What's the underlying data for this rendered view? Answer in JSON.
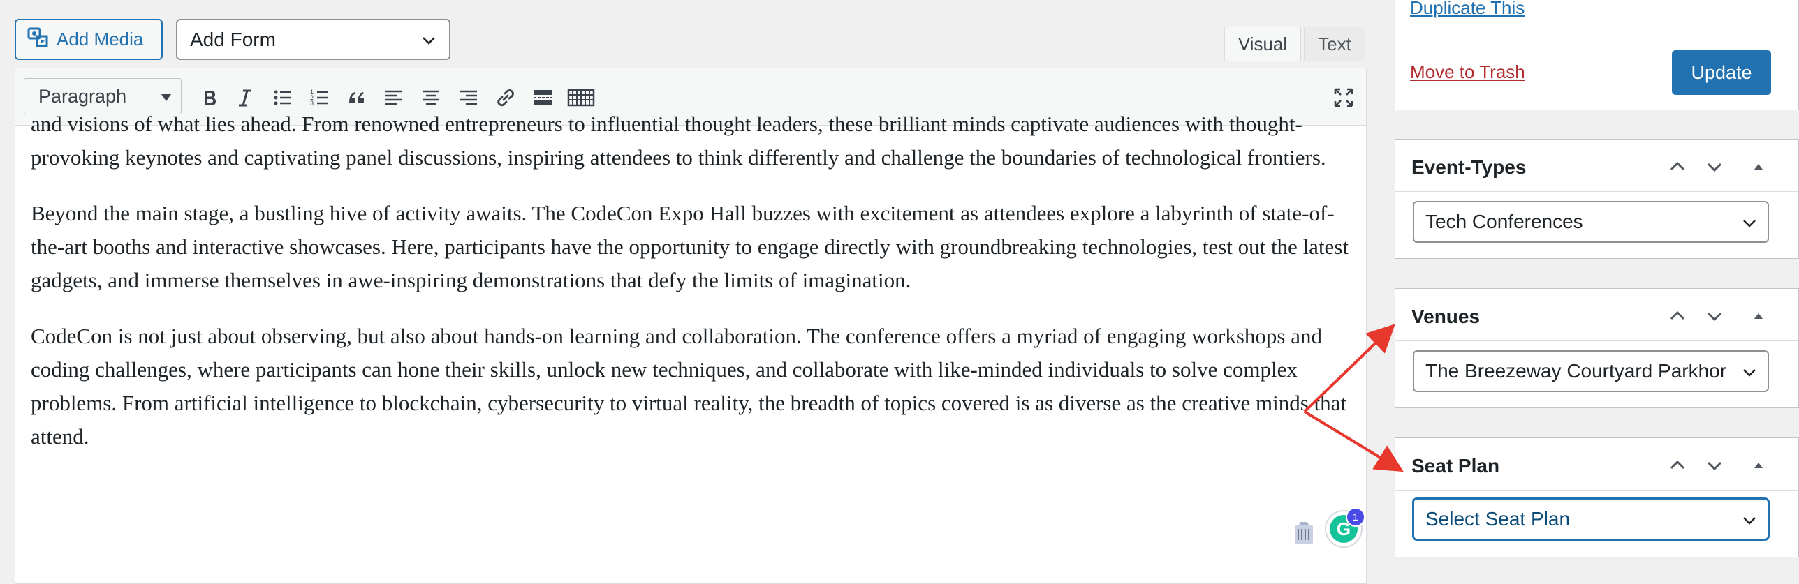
{
  "toolbar_top": {
    "add_media_label": "Add Media",
    "add_form_value": "Add Form",
    "tabs": [
      "Visual",
      "Text"
    ]
  },
  "editor_toolbar": {
    "format_select": "Paragraph",
    "buttons": [
      "bold-icon",
      "italic-icon",
      "bullet-list-icon",
      "numbered-list-icon",
      "blockquote-icon",
      "align-left-icon",
      "align-center-icon",
      "align-right-icon",
      "link-icon",
      "read-more-icon",
      "toolbar-toggle-icon",
      "fullscreen-icon"
    ]
  },
  "content": {
    "paragraphs": [
      "and visions of what lies ahead. From renowned entrepreneurs to influential thought leaders, these brilliant minds captivate audiences with thought-provoking keynotes and captivating panel discussions, inspiring attendees to think differently and challenge the boundaries of technological frontiers.",
      "Beyond the main stage, a bustling hive of activity awaits. The CodeCon Expo Hall buzzes with excitement as attendees explore a labyrinth of state-of-the-art booths and interactive showcases. Here, participants have the opportunity to engage directly with groundbreaking technologies, test out the latest gadgets, and immerse themselves in awe-inspiring demonstrations that defy the limits of imagination.",
      "CodeCon is not just about observing, but also about hands-on learning and collaboration. The conference offers a myriad of engaging workshops and coding challenges, where participants can hone their skills, unlock new techniques, and collaborate with like-minded individuals to solve complex problems. From artificial intelligence to blockchain, cybersecurity to virtual reality, the breadth of topics covered is as diverse as the creative minds that attend."
    ]
  },
  "grammarly": {
    "badge": "1"
  },
  "publish": {
    "duplicate_label": "Duplicate This",
    "trash_label": "Move to Trash",
    "update_label": "Update"
  },
  "panels": {
    "event_types": {
      "title": "Event-Types",
      "value": "Tech Conferences"
    },
    "venues": {
      "title": "Venues",
      "value": "The Breezeway Courtyard Parkhor"
    },
    "seat_plan": {
      "title": "Seat Plan",
      "value": "Select Seat Plan"
    }
  },
  "colors": {
    "accent": "#2271b1",
    "trash": "#b32d2e",
    "annotation_arrow": "#e8382d",
    "grammarly": "#15c39a"
  }
}
